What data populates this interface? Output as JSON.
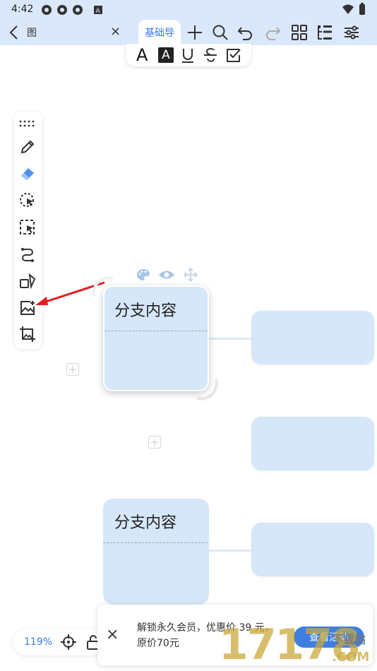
{
  "status_bar": {
    "time": "4:42"
  },
  "top_bar": {
    "tab_inactive": "",
    "tab_inactive_partial": "图",
    "tab_close": "×",
    "tab_active": "基础导"
  },
  "format_bar": {
    "bold_label": "A",
    "highlight_label": "A"
  },
  "nodes": {
    "selected_title": "分支内容",
    "lower_title": "分支内容"
  },
  "zoom": {
    "level": "119%"
  },
  "promo": {
    "text": "解锁永久会员，优惠价 39 元，原价70元",
    "button_label": "查看活动",
    "close": "×"
  },
  "watermark": {
    "number": "17178",
    "site": "下载站",
    "domain": ".COM"
  },
  "colors": {
    "accent": "#3a7be8",
    "node_fill": "#d6e7f9",
    "top_bar_bg": "#dbe8fb",
    "arrow": "#e02020"
  }
}
